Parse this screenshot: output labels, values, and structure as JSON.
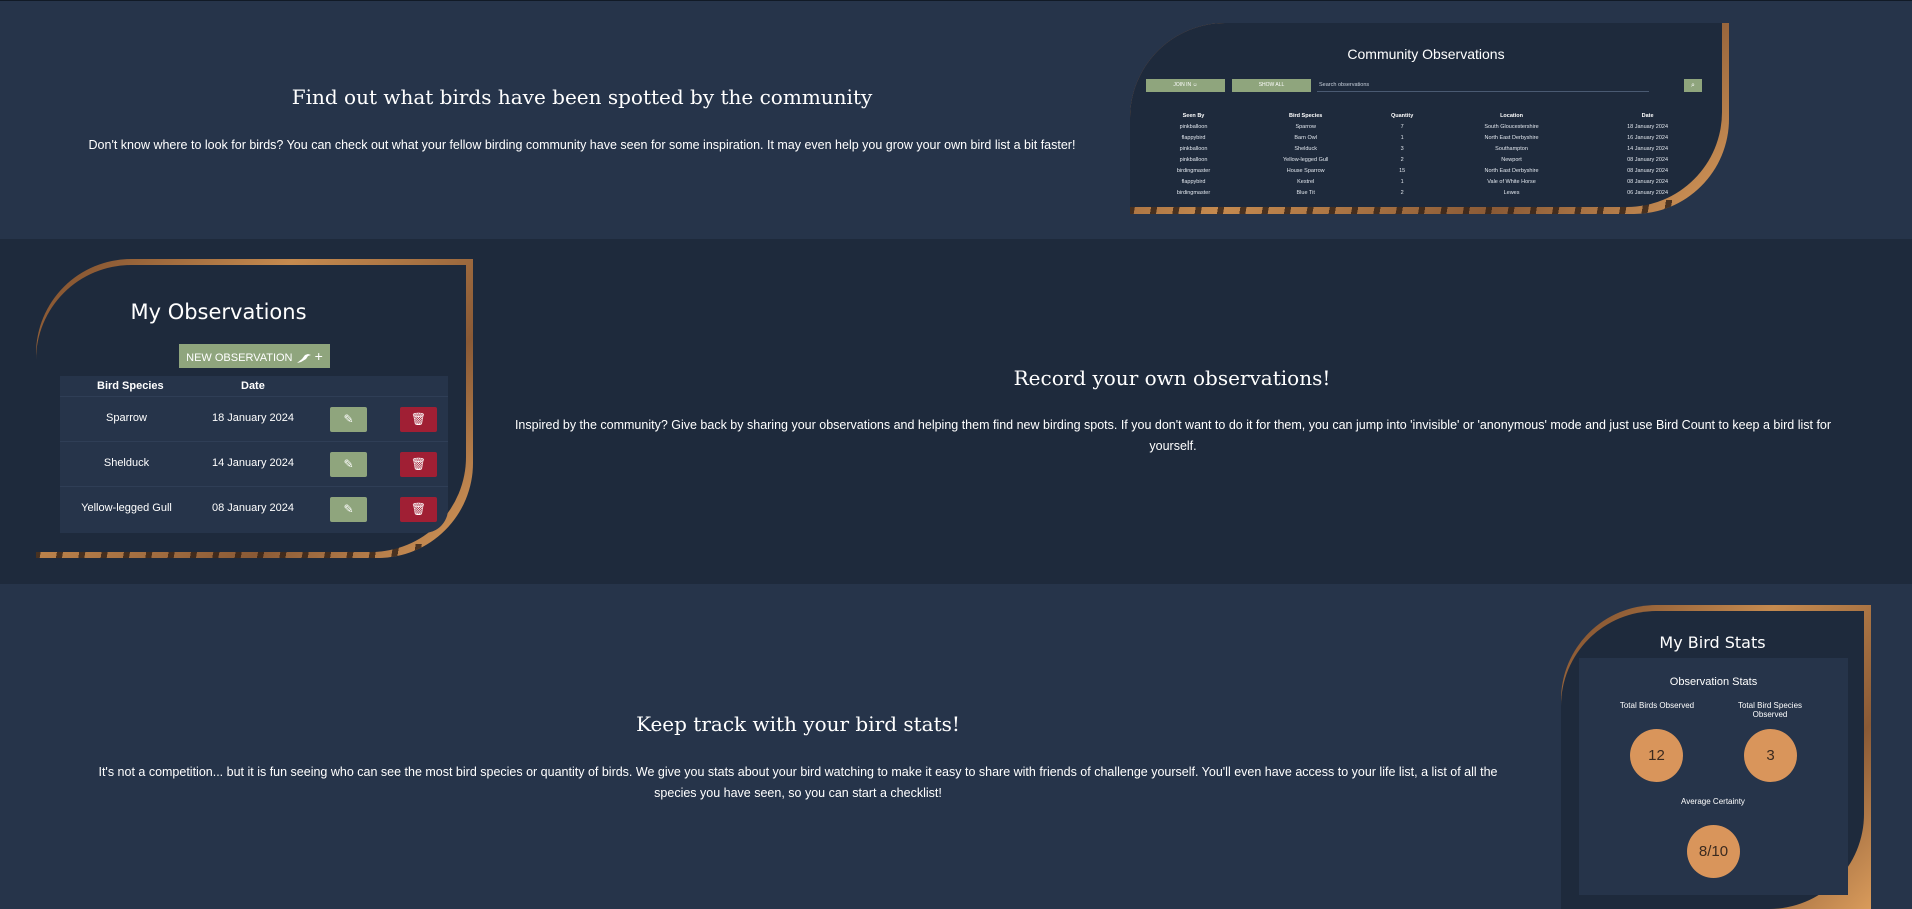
{
  "community_section": {
    "heading": "Find out what birds have been spotted by the community",
    "text": "Don't know where to look for birds? You can check out what your fellow birding community have seen for some inspiration. It may even help you grow your own bird list a bit faster!",
    "card": {
      "title": "Community Observations",
      "join_label": "JOIN IN",
      "show_all_label": "SHOW ALL",
      "search_placeholder": "Search observations",
      "columns": [
        "Seen By",
        "Bird Species",
        "Quantity",
        "Location",
        "Date"
      ],
      "rows": [
        [
          "pinkballoon",
          "Sparrow",
          "7",
          "South Gloucestershire",
          "18 January 2024"
        ],
        [
          "flappybird",
          "Barn Owl",
          "1",
          "North East Derbyshire",
          "16 January 2024"
        ],
        [
          "pinkballoon",
          "Shelduck",
          "3",
          "Southampton",
          "14 January 2024"
        ],
        [
          "pinkballoon",
          "Yellow-legged Gull",
          "2",
          "Newport",
          "08 January 2024"
        ],
        [
          "birdingmaster",
          "House Sparrow",
          "15",
          "North East Derbyshire",
          "08 January 2024"
        ],
        [
          "flappybird",
          "Kestrel",
          "1",
          "Vale of White Horse",
          "08 January 2024"
        ],
        [
          "birdingmaster",
          "Blue Tit",
          "2",
          "Lewes",
          "06 January 2024"
        ]
      ]
    }
  },
  "record_section": {
    "heading": "Record your own observations!",
    "text": "Inspired by the community? Give back by sharing your observations and helping them find new birding spots. If you don't want to do it for them, you can jump into 'invisible' or 'anonymous' mode and just use Bird Count to keep a bird list for yourself.",
    "card": {
      "title": "My Observations",
      "new_button_label": "NEW OBSERVATION",
      "columns": [
        "Bird Species",
        "Date"
      ],
      "rows": [
        {
          "species": "Sparrow",
          "date": "18 January 2024"
        },
        {
          "species": "Shelduck",
          "date": "14 January 2024"
        },
        {
          "species": "Yellow-legged Gull",
          "date": "08 January 2024"
        }
      ]
    }
  },
  "stats_section": {
    "heading": "Keep track with your bird stats!",
    "text": "It's not a competition... but it is fun seeing who can see the most bird species or quantity of birds. We give you stats about your bird watching to make it easy to share with friends of challenge yourself. You'll even have access to your life list, a list of all the species you have seen, so you can start a checklist!",
    "card": {
      "title": "My Bird Stats",
      "subtitle": "Observation Stats",
      "total_birds_label": "Total Birds Observed",
      "total_birds_value": "12",
      "total_species_label": "Total Bird Species Observed",
      "total_species_value": "3",
      "certainty_label": "Average Certainty",
      "certainty_value": "8/10"
    }
  },
  "colors": {
    "page_bg": "#26344a",
    "alt_section_bg": "#1e2a3c",
    "accent_green": "#8fa57d",
    "delete_red": "#a01f34",
    "stat_circle": "#d9955b",
    "frame_copper": "#c58a4f"
  }
}
